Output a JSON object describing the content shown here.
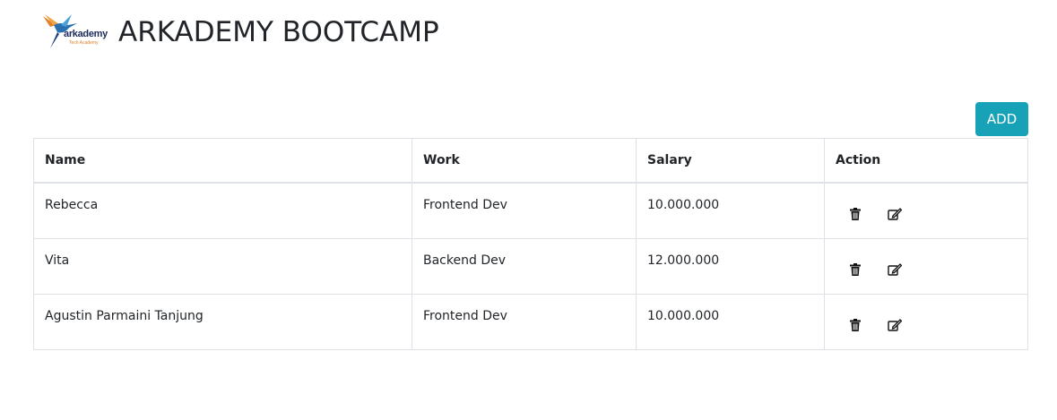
{
  "header": {
    "logo_text": "arkademy",
    "logo_subtext": "Tech Academy",
    "title": "ARKADEMY BOOTCAMP"
  },
  "toolbar": {
    "add_label": "ADD"
  },
  "colors": {
    "accent": "#17a2b8",
    "text": "#212529",
    "border": "#dee2e6"
  },
  "table": {
    "columns": [
      "Name",
      "Work",
      "Salary",
      "Action"
    ],
    "rows": [
      {
        "name": "Rebecca",
        "work": "Frontend Dev",
        "salary": "10.000.000"
      },
      {
        "name": "Vita",
        "work": "Backend Dev",
        "salary": "12.000.000"
      },
      {
        "name": "Agustin Parmaini Tanjung",
        "work": "Frontend Dev",
        "salary": "10.000.000"
      }
    ],
    "row_actions": [
      "trash-icon",
      "edit-icon"
    ]
  }
}
